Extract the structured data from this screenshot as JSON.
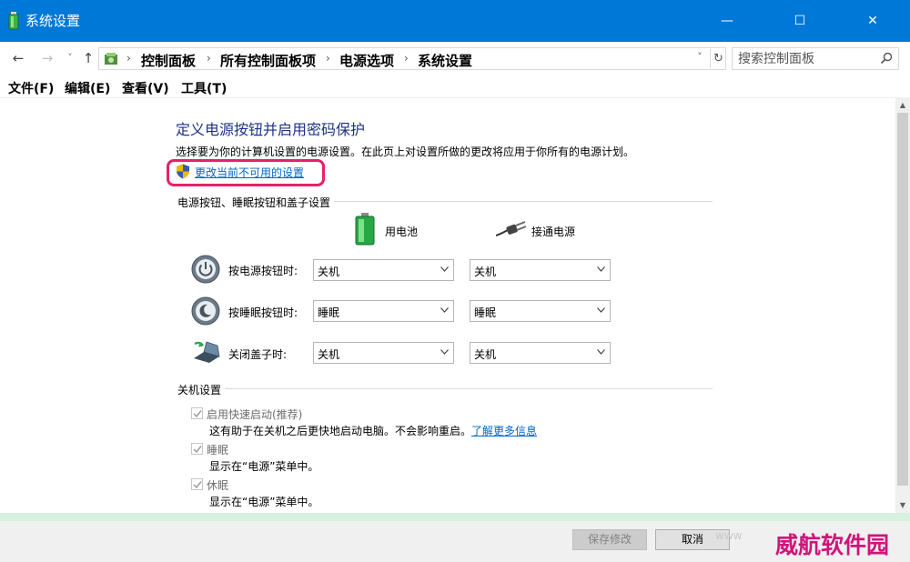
{
  "window": {
    "title": "系统设置",
    "controls": {
      "minimize": "—",
      "maximize": "☐",
      "close": "✕"
    }
  },
  "nav": {
    "back": "←",
    "forward": "→",
    "recent": "˅",
    "up": "↑",
    "breadcrumbs": [
      "控制面板",
      "所有控制面板项",
      "电源选项",
      "系统设置"
    ],
    "separator": "›",
    "dropdown": "˅",
    "refresh": "↻"
  },
  "search": {
    "placeholder": "搜索控制面板"
  },
  "menu": {
    "items": [
      "文件(F)",
      "编辑(E)",
      "查看(V)",
      "工具(T)"
    ]
  },
  "main": {
    "heading": "定义电源按钮并启用密码保护",
    "description": "选择要为你的计算机设置的电源设置。在此页上对设置所做的更改将应用于你所有的电源计划。",
    "change_link": "更改当前不可用的设置",
    "power_group": {
      "label": "电源按钮、睡眠按钮和盖子设置",
      "battery_label": "用电池",
      "plugged_label": "接通电源",
      "rows": [
        {
          "label": "按电源按钮时:",
          "battery": "关机",
          "plugged": "关机"
        },
        {
          "label": "按睡眠按钮时:",
          "battery": "睡眠",
          "plugged": "睡眠"
        },
        {
          "label": "关闭盖子时:",
          "battery": "关机",
          "plugged": "关机"
        }
      ]
    },
    "shutdown_group": {
      "label": "关机设置",
      "items": [
        {
          "label": "启用快速启动(推荐)",
          "desc": "这有助于在关机之后更快地启动电脑。不会影响重启。",
          "link": "了解更多信息",
          "checked": true
        },
        {
          "label": "睡眠",
          "desc": "显示在“电源”菜单中。",
          "checked": true
        },
        {
          "label": "休眠",
          "desc": "显示在“电源”菜单中。",
          "checked": true
        }
      ]
    }
  },
  "scrollbar": {
    "up": "▲",
    "down": "▼"
  },
  "footer": {
    "save": "保存修改",
    "cancel": "取消"
  },
  "watermark": {
    "text": "威航软件园",
    "ghost": "www"
  }
}
